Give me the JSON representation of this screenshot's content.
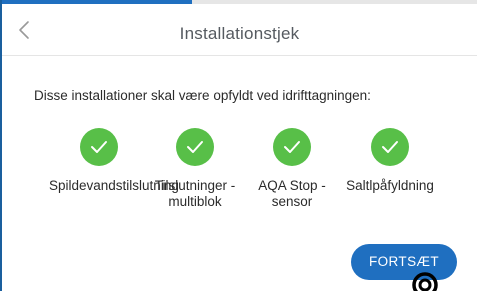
{
  "header": {
    "title": "Installationstjek",
    "back_icon": "chevron-left-icon"
  },
  "progress": {
    "value_percent": 40,
    "color": "#1f6fc0"
  },
  "intro_text": "Disse installationer skal være opfyldt ved idrifttagningen:",
  "checks": [
    {
      "label": "Spildevandstilslutning",
      "icon": "check-icon",
      "status": "ok"
    },
    {
      "label": "Tilslutninger -\nmultiblok",
      "icon": "check-icon",
      "status": "ok"
    },
    {
      "label": "AQA Stop -\nsensor",
      "icon": "check-icon",
      "status": "ok"
    },
    {
      "label": "Saltlpåfyldning",
      "icon": "check-icon",
      "status": "ok"
    }
  ],
  "continue_button": {
    "label": "FORTSÆT"
  },
  "colors": {
    "accent": "#1f6fc0",
    "success": "#58bf48",
    "text": "#2b2b2b",
    "title": "#555a60"
  }
}
